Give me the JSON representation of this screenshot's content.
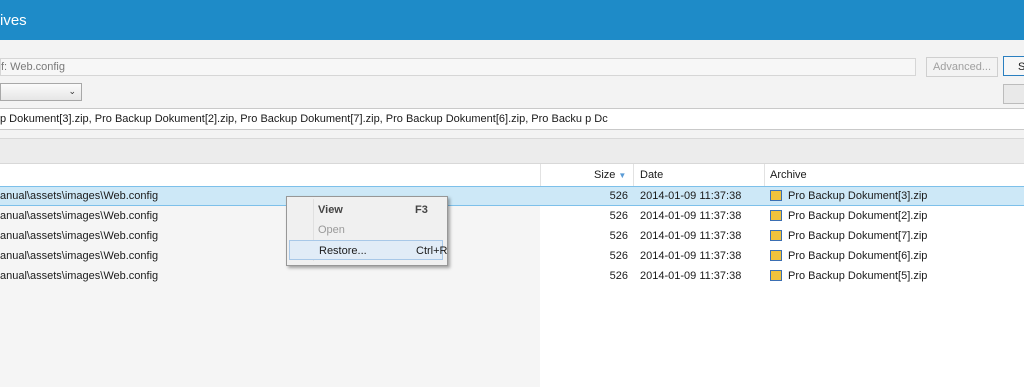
{
  "window": {
    "title_fragment": "ives"
  },
  "search": {
    "value": "f: Web.config"
  },
  "buttons": {
    "advanced": "Advanced...",
    "side_1": "S",
    "side_2": ""
  },
  "archives_line": "p Dokument[3].zip, Pro Backup Dokument[2].zip, Pro Backup Dokument[7].zip, Pro Backup Dokument[6].zip, Pro Backu p Dc",
  "columns": {
    "size": "Size",
    "date": "Date",
    "archive": "Archive"
  },
  "rows": [
    {
      "path": "anual\\assets\\images\\Web.config",
      "size": "526",
      "date": "2014-01-09 11:37:38",
      "archive": "Pro Backup Dokument[3].zip"
    },
    {
      "path": "anual\\assets\\images\\Web.config",
      "size": "526",
      "date": "2014-01-09 11:37:38",
      "archive": "Pro Backup Dokument[2].zip"
    },
    {
      "path": "anual\\assets\\images\\Web.config",
      "size": "526",
      "date": "2014-01-09 11:37:38",
      "archive": "Pro Backup Dokument[7].zip"
    },
    {
      "path": "anual\\assets\\images\\Web.config",
      "size": "526",
      "date": "2014-01-09 11:37:38",
      "archive": "Pro Backup Dokument[6].zip"
    },
    {
      "path": "anual\\assets\\images\\Web.config",
      "size": "526",
      "date": "2014-01-09 11:37:38",
      "archive": "Pro Backup Dokument[5].zip"
    }
  ],
  "context_menu": {
    "view": {
      "label": "View",
      "key": "F3"
    },
    "open": {
      "label": "Open"
    },
    "restore": {
      "label": "Restore...",
      "key": "Ctrl+R"
    }
  },
  "colors": {
    "titlebar": "#1e8bc8",
    "selection": "#cde8f7"
  }
}
